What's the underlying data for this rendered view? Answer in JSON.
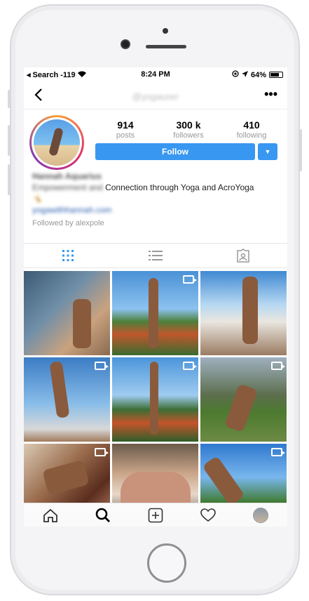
{
  "status_bar": {
    "back_app": "Search",
    "signal": "-119",
    "time": "8:24 PM",
    "battery": "64%"
  },
  "header": {
    "username": "@yogauser",
    "more_label": "•••"
  },
  "profile": {
    "posts_count": "914",
    "posts_label": "posts",
    "followers_count": "300 k",
    "followers_label": "followers",
    "following_count": "410",
    "following_label": "following",
    "follow_label": "Follow",
    "dropdown_label": "▼"
  },
  "bio": {
    "name": "Hannah Aquarius",
    "category": "Empowerment and",
    "tagline": "Connection through Yoga and AcroYoga",
    "emoji_line": "🤸",
    "link": "yogawithhannah.com",
    "followed_by": "Followed by alexpole"
  },
  "grid": {
    "items": [
      {
        "kind": "photo",
        "video": false,
        "bg": "linear-gradient(135deg,#3c5a74 0%,#6f8fa8 40%,#c9a27f 70%,#8a6a4e 100%)"
      },
      {
        "kind": "photo",
        "video": true,
        "bg": "linear-gradient(#4a91d6 0%,#8cc2ef 45%,#4c7f3a 60%,#c0572c 75%,#3a6b2f 100%)"
      },
      {
        "kind": "photo",
        "video": false,
        "bg": "linear-gradient(#3f89d2 0%,#b7d8f2 40%,#e9e6df 60%,#9b7b62 100%)"
      },
      {
        "kind": "photo",
        "video": true,
        "bg": "linear-gradient(#3b7cc4 0%,#89bde9 55%,#d8d8d8 85%,#a07a5a 100%)"
      },
      {
        "kind": "photo",
        "video": true,
        "bg": "linear-gradient(#4c95db 0%,#9fcbf0 45%,#3c6e34 62%,#c4542b 78%,#2f5e29 100%)"
      },
      {
        "kind": "photo",
        "video": true,
        "bg": "linear-gradient(#9fb0bf 0%,#5c6e4d 45%,#4c7a2f 65%,#6d8a43 100%)"
      },
      {
        "kind": "photo",
        "video": true,
        "bg": "linear-gradient(135deg,#d9c9b3 0%,#9a6b4c 40%,#5a2d1e 70%,#c48d6e 100%)"
      },
      {
        "kind": "photo",
        "video": false,
        "bg": "linear-gradient(#6b5a4a 0%,#c9a589 35%,#e7d7c8 60%,#3c3430 100%)"
      },
      {
        "kind": "photo",
        "video": true,
        "bg": "linear-gradient(#2f78cf 0%,#78b6ec 40%,#3f7a2f 70%,#2a5a22 100%)"
      }
    ]
  },
  "icons": {
    "grid": "grid-icon",
    "list": "list-icon",
    "tagged": "tagged-icon",
    "home": "home-icon",
    "search": "search-icon",
    "add": "add-icon",
    "heart": "heart-icon",
    "profile": "profile-avatar-icon"
  },
  "colors": {
    "accent": "#3897f0",
    "muted": "#999999"
  }
}
